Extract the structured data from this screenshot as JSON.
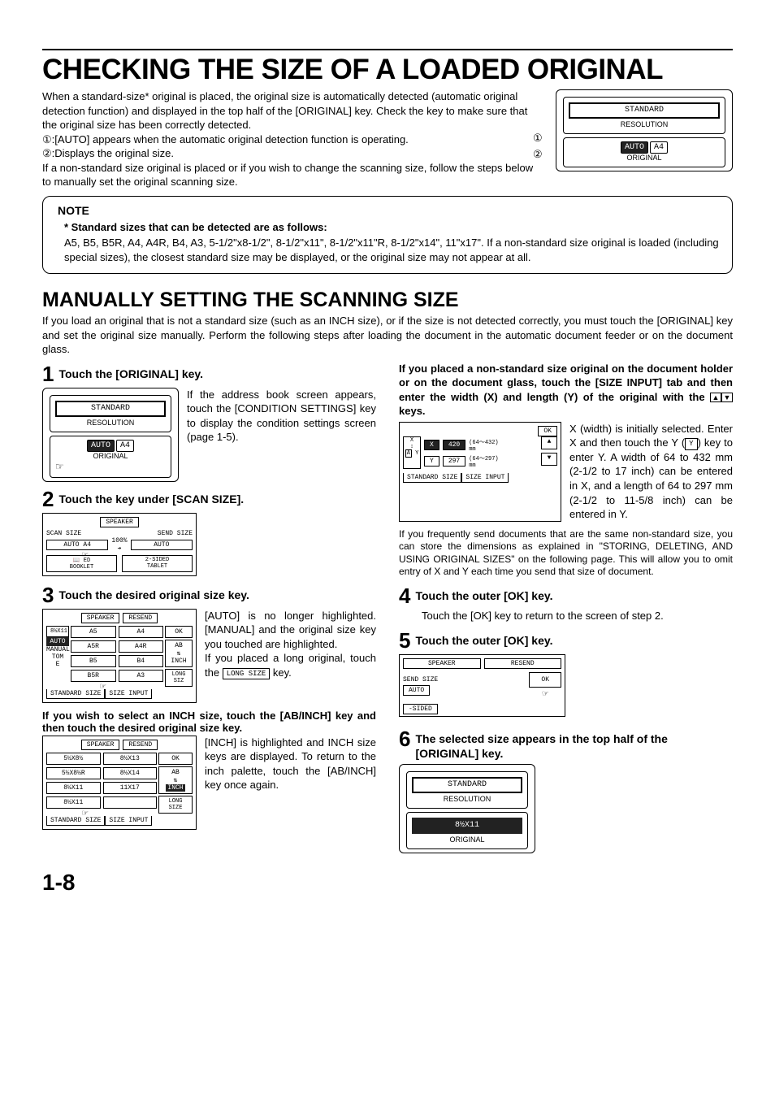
{
  "title": "CHECKING THE SIZE OF A LOADED ORIGINAL",
  "intro": {
    "p1": "When a standard-size* original is placed, the original size is automatically detected (automatic original detection function) and displayed in the top half of the [ORIGINAL] key. Check the key to make sure that the original size has been correctly detected.",
    "b1_label": "①",
    "b1": ":[AUTO] appears when the automatic original detection function is operating.",
    "b2_label": "②",
    "b2": ":Displays the original size.",
    "p2": "If a non-standard size original is placed or if you wish to change the scanning size, follow the steps below to manually set the original scanning size."
  },
  "lcd_top": {
    "standard": "STANDARD",
    "resolution": "RESOLUTION",
    "auto": "AUTO",
    "a4": "A4",
    "original": "ORIGINAL",
    "c1": "①",
    "c2": "②"
  },
  "note": {
    "head": "NOTE",
    "lead": "* Standard sizes that can be detected are as follows:",
    "body": "A5, B5, B5R, A4, A4R, B4, A3, 5-1/2\"x8-1/2\", 8-1/2\"x11\", 8-1/2\"x11\"R, 8-1/2\"x14\", 11\"x17\". If a non-standard size original is loaded (including special sizes), the closest standard size may be displayed, or the original size may not appear at all."
  },
  "h2": "MANUALLY SETTING THE SCANNING SIZE",
  "h2_para": "If you load an original that is not a standard size (such as an INCH size), or if the size is not detected correctly, you must touch the [ORIGINAL] key and set the original size manually. Perform the following steps after loading the document in the automatic document feeder or on the document glass.",
  "steps": {
    "s1_num": "1",
    "s1_title": "Touch the [ORIGINAL] key.",
    "s1_text": "If the address book screen appears, touch the [CONDITION SETTINGS] key to display the condition settings screen (page 1-5).",
    "s2_num": "2",
    "s2_title": "Touch the key under [SCAN SIZE].",
    "s3_num": "3",
    "s3_title": "Touch the desired original size key.",
    "s3_text1": "[AUTO] is no longer highlighted. [MANUAL] and the original size key you touched are highlighted.",
    "s3_text2": "If you placed a long original, touch the ",
    "s3_key": "LONG SIZE",
    "s3_text3": " key.",
    "s3_sub": "If you wish to select an INCH size, touch the [AB/INCH] key and then touch the desired original size key.",
    "s3_text4": "[INCH] is highlighted and INCH size keys are displayed. To return to the inch palette, touch the [AB/INCH] key once again.",
    "right_lead": "If you placed a non-standard size original on the document holder or on the document glass, touch the [SIZE INPUT] tab and then enter the width (X) and length (Y) of the original with the ",
    "right_lead2": " keys.",
    "right_text": "X (width) is initially selected. Enter X and then touch the Y (",
    "right_text_y": "Y",
    "right_text2": ") key to enter Y. A width of 64 to 432 mm (2-1/2 to 17 inch) can be entered in X, and a length of 64 to 297 mm (2-1/2 to 11-5/8 inch) can be entered in Y.",
    "right_text3": "If you frequently send documents that are the same non-standard size, you can store the dimensions as explained in \"STORING, DELETING, AND USING ORIGINAL SIZES\" on the following page. This will allow you to omit entry of X and Y each time you send that size of document.",
    "s4_num": "4",
    "s4_title": "Touch the outer [OK] key.",
    "s4_text": "Touch the [OK] key to return to the screen of step 2.",
    "s5_num": "5",
    "s5_title": "Touch the outer [OK] key.",
    "s6_num": "6",
    "s6_title": "The selected size appears in the top half of the [ORIGINAL] key."
  },
  "panel2": {
    "speaker": "SPEAKER",
    "scan_size": "SCAN SIZE",
    "send_size": "SEND SIZE",
    "auto_a4": "AUTO  A4",
    "pct": "100%",
    "auto": "AUTO",
    "booklet": "BOOKLET",
    "twosided_tablet": "2-SIDED\nTABLET"
  },
  "panel3a": {
    "speaker": "SPEAKER",
    "resend": "RESEND",
    "ok": "OK",
    "hint": "8½X11",
    "a5": "A5",
    "a4": "A4",
    "a5r": "A5R",
    "a4r": "A4R",
    "b5": "B5",
    "b4": "B4",
    "b5r": "B5R",
    "a3": "A3",
    "auto": "AUTO",
    "manual": "MANUAL",
    "tom": "TOM",
    "ab": "AB",
    "inch": "INCH",
    "long": "LONG SIZ",
    "t1": "STANDARD SIZE",
    "t2": "SIZE INPUT"
  },
  "panel3b": {
    "speaker": "SPEAKER",
    "resend": "RESEND",
    "ok": "OK",
    "s1": "5½X8½",
    "s2": "8½X13",
    "s3": "5½X8½R",
    "s4": "8½X14",
    "s5": "8½X11",
    "s6": "11X17",
    "s7": "8½X11",
    "ab": "AB",
    "inch": "INCH",
    "long": "LONG SIZE",
    "t1": "STANDARD SIZE",
    "t2": "SIZE INPUT"
  },
  "panelXY": {
    "ok": "OK",
    "x": "X",
    "y": "Y",
    "xv": "420",
    "yv": "297",
    "xr": "(64～432)\nmm",
    "yr": "(64～297)\nmm",
    "t1": "STANDARD SIZE",
    "t2": "SIZE INPUT"
  },
  "panel5": {
    "speaker": "SPEAKER",
    "resend": "RESEND",
    "send_size": "SEND SIZE",
    "ok": "OK",
    "auto": "AUTO",
    "sided": "-SIDED"
  },
  "panel6": {
    "standard": "STANDARD",
    "resolution": "RESOLUTION",
    "size": "8½X11",
    "original": "ORIGINAL"
  },
  "pagenum": "1-8"
}
